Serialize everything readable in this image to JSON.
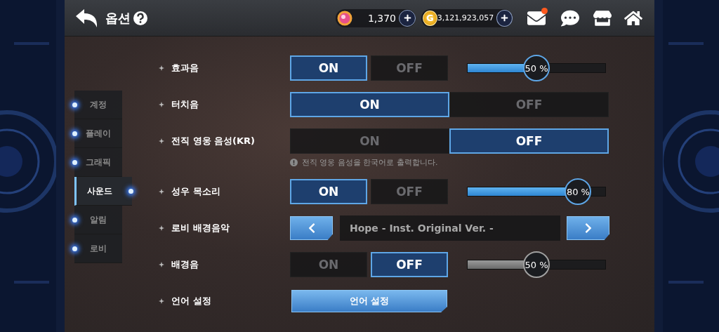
{
  "header": {
    "title": "옵션",
    "currencies": [
      {
        "kind": "gem",
        "amount": "1,370"
      },
      {
        "kind": "gold",
        "symbol": "G",
        "amount": "3,121,923,057"
      }
    ],
    "mail": {
      "has_notification": true
    }
  },
  "sidebar": {
    "items": [
      {
        "label": "계정",
        "selected": false
      },
      {
        "label": "플레이",
        "selected": false
      },
      {
        "label": "그래픽",
        "selected": false
      },
      {
        "label": "사운드",
        "selected": true
      },
      {
        "label": "알림",
        "selected": false
      },
      {
        "label": "로비",
        "selected": false
      }
    ]
  },
  "settings": [
    {
      "kind": "toggle",
      "label": "효과음",
      "options": [
        {
          "label": "ON",
          "selected": true
        },
        {
          "label": "OFF",
          "selected": false
        }
      ],
      "slider": {
        "level": 0.5,
        "reading": "50 %",
        "enabled": true
      }
    },
    {
      "kind": "wide_toggle",
      "label": "터치음",
      "options": [
        {
          "label": "ON",
          "selected": true
        },
        {
          "label": "OFF",
          "selected": false
        }
      ]
    },
    {
      "kind": "wide_toggle",
      "label": "전직 영웅 음성(KR)",
      "options": [
        {
          "label": "ON",
          "selected": false
        },
        {
          "label": "OFF",
          "selected": true
        }
      ],
      "note": "전직 영웅 음성을 한국어로 출력합니다."
    },
    {
      "kind": "toggle",
      "label": "성우 목소리",
      "options": [
        {
          "label": "ON",
          "selected": true
        },
        {
          "label": "OFF",
          "selected": false
        }
      ],
      "slider": {
        "level": 0.8,
        "reading": "80 %",
        "enabled": true
      }
    },
    {
      "kind": "selector",
      "label": "로비 배경음악",
      "value": "Hope - Inst. Original Ver. -"
    },
    {
      "kind": "toggle",
      "label": "배경음",
      "options": [
        {
          "label": "ON",
          "selected": false
        },
        {
          "label": "OFF",
          "selected": true
        }
      ],
      "slider": {
        "level": 0.5,
        "reading": "50 %",
        "enabled": false
      }
    },
    {
      "kind": "button",
      "label": "언어 설정",
      "button": "언어 설정"
    }
  ]
}
